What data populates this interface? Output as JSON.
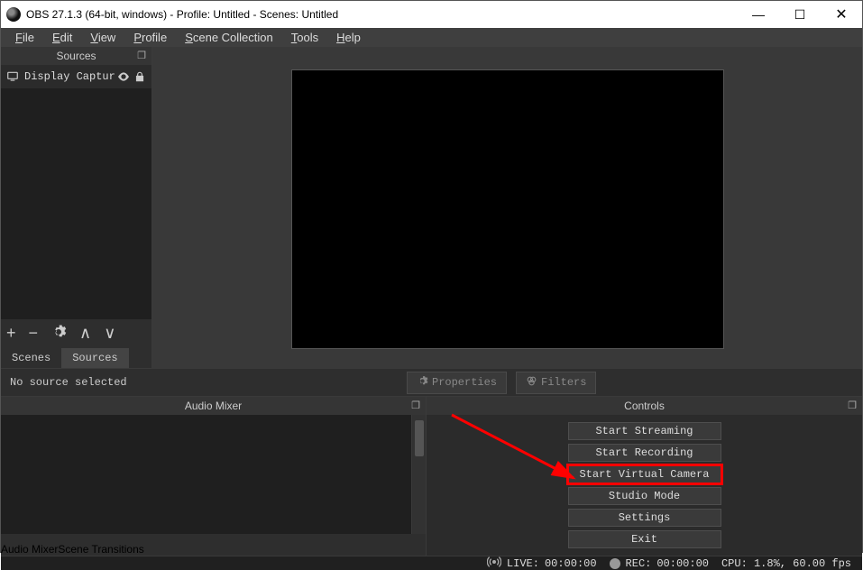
{
  "titlebar": {
    "title": "OBS 27.1.3 (64-bit, windows) - Profile: Untitled - Scenes: Untitled"
  },
  "menubar": [
    "File",
    "Edit",
    "View",
    "Profile",
    "Scene Collection",
    "Tools",
    "Help"
  ],
  "sources_panel": {
    "title": "Sources",
    "item": "Display Captur"
  },
  "left_tabs": {
    "scenes": "Scenes",
    "sources": "Sources"
  },
  "mid": {
    "status": "No source selected",
    "properties": "Properties",
    "filters": "Filters"
  },
  "mixer": {
    "title": "Audio Mixer"
  },
  "bottom_tabs": {
    "mixer": "Audio Mixer",
    "transitions": "Scene Transitions"
  },
  "controls": {
    "title": "Controls",
    "buttons": [
      "Start Streaming",
      "Start Recording",
      "Start Virtual Camera",
      "Studio Mode",
      "Settings",
      "Exit"
    ],
    "highlight_index": 2
  },
  "statusbar": {
    "live_label": "LIVE:",
    "live_time": "00:00:00",
    "rec_label": "REC:",
    "rec_time": "00:00:00",
    "cpu": "CPU: 1.8%, 60.00 fps"
  }
}
